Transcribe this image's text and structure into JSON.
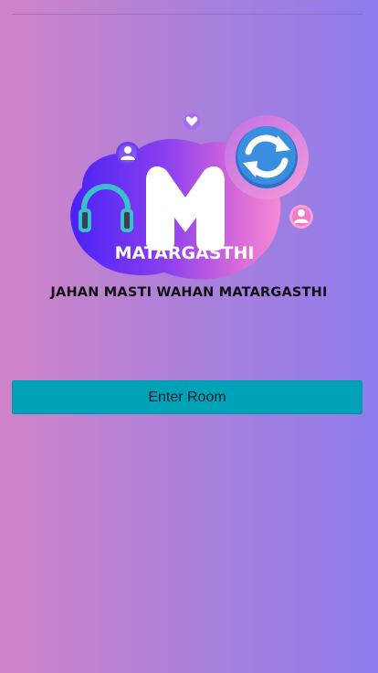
{
  "logo": {
    "letter": "M",
    "brand_name": "MATARGASTHI",
    "tagline": "JAHAN MASTI WAHAN MATARGASTHI"
  },
  "actions": {
    "enter_room_label": "Enter Room"
  },
  "colors": {
    "background_left": "#d083c8",
    "background_right": "#8f7cec",
    "button": "#00a2b8",
    "logo_blob_dark": "#5b2cf0",
    "logo_blob_pink": "#f07ad0",
    "refresh_circle": "#3a8ee0"
  },
  "icons": [
    "headphones-icon",
    "user-icon",
    "heart-icon",
    "refresh-icon",
    "user-icon"
  ]
}
